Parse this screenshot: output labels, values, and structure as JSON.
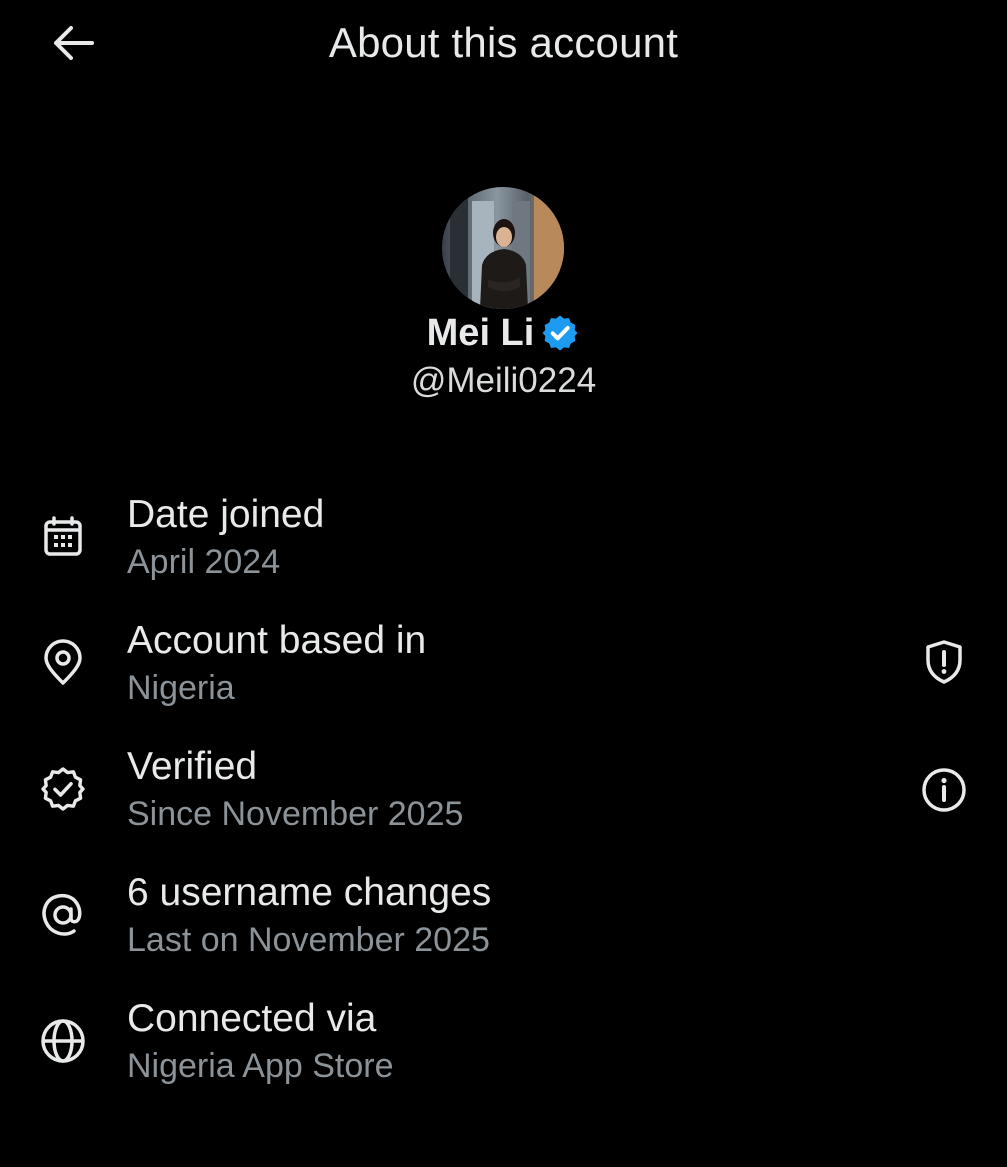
{
  "header": {
    "title": "About this account",
    "back_icon": "arrow-left-icon"
  },
  "profile": {
    "display_name": "Mei Li",
    "handle": "@Meili0224",
    "verified_icon": "verified-badge-icon",
    "verified_color": "#1d9bf0"
  },
  "rows": [
    {
      "icon": "calendar-icon",
      "title": "Date joined",
      "subtitle": "April 2024"
    },
    {
      "icon": "location-pin-icon",
      "title": "Account based in",
      "subtitle": "Nigeria",
      "action_icon": "shield-alert-icon"
    },
    {
      "icon": "verified-outline-icon",
      "title": "Verified",
      "subtitle": "Since November 2025",
      "action_icon": "info-icon"
    },
    {
      "icon": "at-sign-icon",
      "title": "6 username changes",
      "subtitle": "Last on November 2025"
    },
    {
      "icon": "globe-icon",
      "title": "Connected via",
      "subtitle": "Nigeria App Store"
    }
  ],
  "colors": {
    "background": "#000000",
    "primary_text": "#e7e9ea",
    "secondary_text": "#8b9298",
    "accent": "#1d9bf0"
  }
}
